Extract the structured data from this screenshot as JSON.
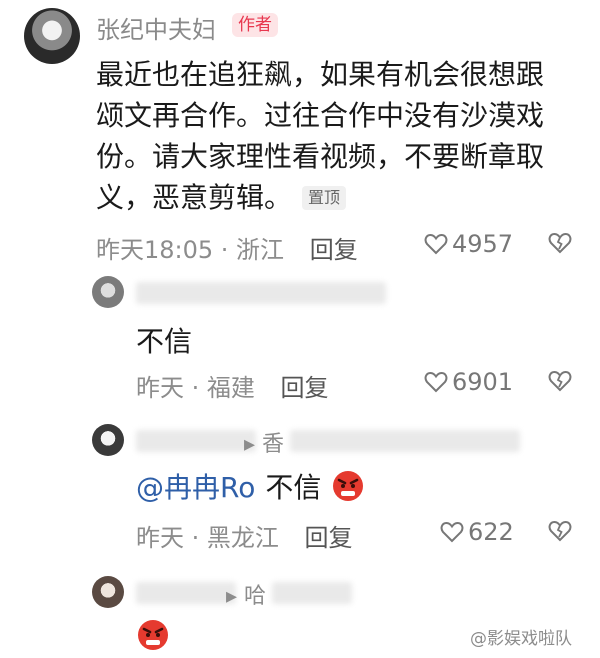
{
  "main_comment": {
    "author": "张纪中夫妇",
    "badge": "作者",
    "lines": [
      "最近也在追狂飙，如果有机会很想跟",
      "颂文再合作。过往合作中没有沙漠戏",
      "份。请大家理性看视频，不要断章取",
      "义，恶意剪辑。"
    ],
    "pin_label": "置顶",
    "time_location": "昨天18:05 · 浙江",
    "reply_label": "回复",
    "likes": "4957"
  },
  "reply_1": {
    "author": "",
    "text": "不信",
    "time_location": "昨天 · 福建",
    "reply_label": "回复",
    "likes": "6901"
  },
  "reply_2": {
    "author_partial": "▸ 香",
    "mention": "@冉冉Ro",
    "text": "不信",
    "time_location": "昨天 · 黑龙江",
    "reply_label": "回复",
    "likes": "622"
  },
  "reply_3": {
    "author_partial": "▸ 哈",
    "text": ""
  },
  "watermark": "@影娱戏啦队",
  "icons": {
    "like": "heart-icon",
    "dislike": "broken-heart-icon",
    "angry_emoji": "angry-face-emoji"
  },
  "colors": {
    "badge_bg": "#fde4e6",
    "badge_text": "#e8374f",
    "mention": "#2f5fa8",
    "meta": "#8c8c8c"
  }
}
